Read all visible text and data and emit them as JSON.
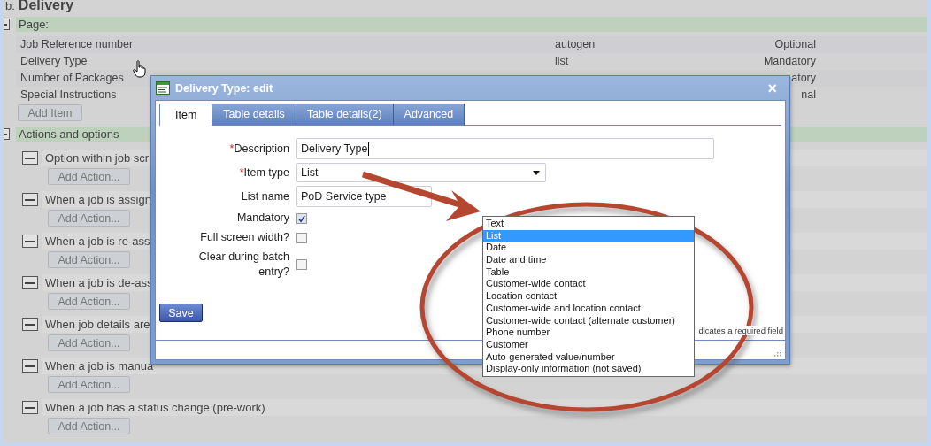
{
  "heading": {
    "prefix": "b:",
    "title": "Delivery"
  },
  "page_section": {
    "title": "Page:",
    "expanded": true,
    "fields": [
      {
        "name": "Job Reference number",
        "type": "autogen",
        "requirement": "Optional"
      },
      {
        "name": "Delivery Type",
        "type": "list",
        "requirement": "Mandatory"
      },
      {
        "name": "Number of Packages",
        "requirement": "atory"
      },
      {
        "name": "Special Instructions",
        "requirement": "nal"
      }
    ],
    "add_button": "Add Item"
  },
  "actions_section": {
    "title": "Actions and options",
    "expanded": true,
    "items": [
      {
        "label": "Option within job scr",
        "expanded": true,
        "button": "Add Action..."
      },
      {
        "label": "When a job is assign",
        "expanded": true,
        "button": "Add Action..."
      },
      {
        "label": "When a job is re-ass",
        "expanded": true,
        "button": "Add Action..."
      },
      {
        "label": "When a job is de-ass",
        "expanded": true,
        "button": "Add Action..."
      },
      {
        "label": "When job details are",
        "expanded": true,
        "button": "Add Action..."
      },
      {
        "label": "When a job is manua",
        "expanded": true,
        "button": "Add Action..."
      },
      {
        "label": "When a job has a status change (pre-work)",
        "expanded": true,
        "button": "Add Action..."
      }
    ]
  },
  "dialog": {
    "title": "Delivery Type: edit",
    "close": "×",
    "tabs": [
      {
        "label": "Item",
        "selected": true
      },
      {
        "label": "Table details",
        "selected": false
      },
      {
        "label": "Table details(2)",
        "selected": false
      },
      {
        "label": "Advanced",
        "selected": false
      }
    ],
    "fields": [
      {
        "kind": "text",
        "marker": "*",
        "label": "Description",
        "value": "Delivery Type"
      },
      {
        "kind": "select",
        "marker": "*",
        "label": "Item type",
        "value": "List"
      },
      {
        "kind": "text",
        "label": "List name",
        "value": "PoD Service type"
      },
      {
        "kind": "checkbox",
        "label": "Mandatory",
        "checked": true
      },
      {
        "kind": "checkbox",
        "label": "Full screen width?",
        "checked": false
      },
      {
        "kind": "checkbox",
        "label": "Clear during batch entry?",
        "checked": false
      }
    ],
    "save_button": "Save",
    "required_note": "dicates a required field"
  },
  "dropdown": {
    "options": [
      {
        "label": "Text",
        "selected": false
      },
      {
        "label": "List",
        "selected": true
      },
      {
        "label": "Date",
        "selected": false
      },
      {
        "label": "Date and time",
        "selected": false
      },
      {
        "label": "Table",
        "selected": false
      },
      {
        "label": "Customer-wide contact",
        "selected": false
      },
      {
        "label": "Location contact",
        "selected": false
      },
      {
        "label": "Customer-wide and location contact",
        "selected": false
      },
      {
        "label": "Customer-wide contact (alternate customer)",
        "selected": false
      },
      {
        "label": "Phone number",
        "selected": false
      },
      {
        "label": "Customer",
        "selected": false
      },
      {
        "label": "Auto-generated value/number",
        "selected": false
      },
      {
        "label": "Display-only information (not saved)",
        "selected": false
      }
    ]
  }
}
